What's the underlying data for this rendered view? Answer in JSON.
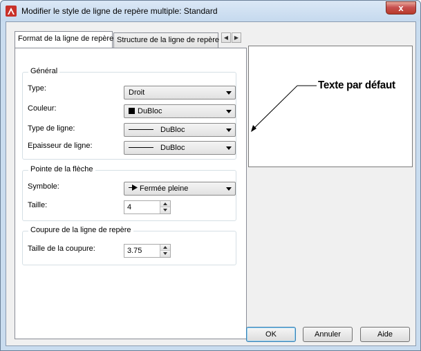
{
  "window": {
    "title": "Modifier le style de ligne de repère multiple: Standard",
    "close_label": "x"
  },
  "tabs": [
    {
      "label": "Format de la ligne de repère",
      "active": true
    },
    {
      "label": "Structure de la ligne de repère",
      "active": false
    }
  ],
  "general": {
    "legend": "Général",
    "type_label": "Type:",
    "type_value": "Droit",
    "color_label": "Couleur:",
    "color_value": "DuBloc",
    "linetype_label": "Type de ligne:",
    "linetype_value": "DuBloc",
    "lineweight_label": "Epaisseur de ligne:",
    "lineweight_value": "DuBloc"
  },
  "arrowhead": {
    "legend": "Pointe de la flèche",
    "symbol_label": "Symbole:",
    "symbol_value": "Fermée pleine",
    "size_label": "Taille:",
    "size_value": "4"
  },
  "break": {
    "legend": "Coupure de la ligne de repère",
    "size_label": "Taille de la coupure:",
    "size_value": "3.75"
  },
  "preview": {
    "text": "Texte par défaut"
  },
  "buttons": {
    "ok": "OK",
    "cancel": "Annuler",
    "help": "Aide"
  },
  "colors": {
    "accent": "#3c7fb1",
    "titlebar": "#c9dcef",
    "close": "#c75050"
  }
}
